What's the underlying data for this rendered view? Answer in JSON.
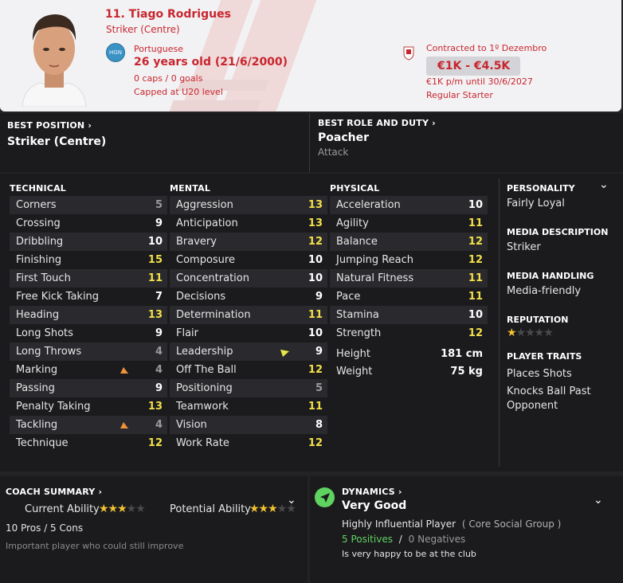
{
  "player": {
    "name": "11. Tiago Rodrigues",
    "position": "Striker (Centre)",
    "nationality_code": "HGN",
    "nationality": "Portuguese",
    "age": "26 years old (21/6/2000)",
    "caps": "0 caps / 0 goals",
    "capped": "Capped at U20 level",
    "contract_club": "Contracted to 1º Dezembro",
    "value": "€1K - €4.5K",
    "wage": "€1K p/m until 30/6/2027",
    "status": "Regular Starter"
  },
  "best_position": {
    "label": "BEST POSITION",
    "value": "Striker (Centre)"
  },
  "best_role": {
    "label": "BEST ROLE AND DUTY",
    "role": "Poacher",
    "duty": "Attack"
  },
  "technical": {
    "title": "TECHNICAL",
    "rows": [
      {
        "name": "Corners",
        "value": "5"
      },
      {
        "name": "Crossing",
        "value": "9"
      },
      {
        "name": "Dribbling",
        "value": "10"
      },
      {
        "name": "Finishing",
        "value": "15"
      },
      {
        "name": "First Touch",
        "value": "11"
      },
      {
        "name": "Free Kick Taking",
        "value": "7"
      },
      {
        "name": "Heading",
        "value": "13"
      },
      {
        "name": "Long Shots",
        "value": "9"
      },
      {
        "name": "Long Throws",
        "value": "4"
      },
      {
        "name": "Marking",
        "value": "4"
      },
      {
        "name": "Passing",
        "value": "9"
      },
      {
        "name": "Penalty Taking",
        "value": "13"
      },
      {
        "name": "Tackling",
        "value": "4"
      },
      {
        "name": "Technique",
        "value": "12"
      }
    ]
  },
  "mental": {
    "title": "MENTAL",
    "rows": [
      {
        "name": "Aggression",
        "value": "13"
      },
      {
        "name": "Anticipation",
        "value": "13"
      },
      {
        "name": "Bravery",
        "value": "12"
      },
      {
        "name": "Composure",
        "value": "10"
      },
      {
        "name": "Concentration",
        "value": "10"
      },
      {
        "name": "Decisions",
        "value": "9"
      },
      {
        "name": "Determination",
        "value": "11"
      },
      {
        "name": "Flair",
        "value": "10"
      },
      {
        "name": "Leadership",
        "value": "9"
      },
      {
        "name": "Off The Ball",
        "value": "12"
      },
      {
        "name": "Positioning",
        "value": "5"
      },
      {
        "name": "Teamwork",
        "value": "11"
      },
      {
        "name": "Vision",
        "value": "8"
      },
      {
        "name": "Work Rate",
        "value": "12"
      }
    ]
  },
  "physical": {
    "title": "PHYSICAL",
    "rows": [
      {
        "name": "Acceleration",
        "value": "10"
      },
      {
        "name": "Agility",
        "value": "11"
      },
      {
        "name": "Balance",
        "value": "12"
      },
      {
        "name": "Jumping Reach",
        "value": "12"
      },
      {
        "name": "Natural Fitness",
        "value": "11"
      },
      {
        "name": "Pace",
        "value": "11"
      },
      {
        "name": "Stamina",
        "value": "10"
      },
      {
        "name": "Strength",
        "value": "12"
      }
    ],
    "height_label": "Height",
    "height": "181 cm",
    "weight_label": "Weight",
    "weight": "75 kg"
  },
  "side": {
    "personality_label": "PERSONALITY",
    "personality": "Fairly Loyal",
    "media_desc_label": "MEDIA DESCRIPTION",
    "media_desc": "Striker",
    "media_handling_label": "MEDIA HANDLING",
    "media_handling": "Media-friendly",
    "reputation_label": "REPUTATION",
    "reputation_stars": 1,
    "traits_label": "PLAYER TRAITS",
    "trait1": "Places Shots",
    "trait2a": "Knocks Ball Past",
    "trait2b": "Opponent"
  },
  "coach": {
    "label": "COACH SUMMARY",
    "current_label": "Current Ability",
    "current_stars": 3,
    "potential_label": "Potential Ability",
    "potential_stars": 3,
    "pros_cons": "10 Pros / 5 Cons",
    "summary": "Important player who could still improve"
  },
  "dynamics": {
    "label": "DYNAMICS",
    "value": "Very Good",
    "influence": "Highly Influential Player",
    "group": "( Core Social Group )",
    "positives": "5 Positives",
    "sep": "/",
    "negatives": "0 Negatives",
    "happiness": "Is very happy to be at the club"
  },
  "colors": {
    "accent_red": "#c8262e",
    "high_value": "#f2e04a",
    "positive_green": "#5fd35f"
  }
}
